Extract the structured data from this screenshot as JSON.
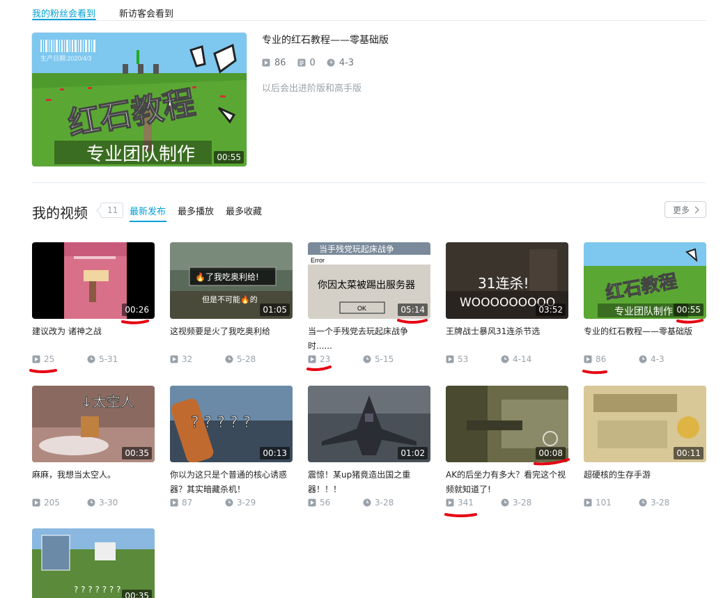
{
  "top_tabs": [
    {
      "label": "我的粉丝会看到",
      "active": true
    },
    {
      "label": "新访客会看到",
      "active": false
    }
  ],
  "featured": {
    "title": "专业的红石教程——零基础版",
    "plays": "86",
    "danmaku": "0",
    "date": "4-3",
    "description": "以后会出进阶版和高手版",
    "duration": "00:55",
    "thumb_text_main": "红石教程",
    "thumb_text_sub": "专业团队制作",
    "thumb_text_date": "生产日期:2020/4/3"
  },
  "videos_section": {
    "title": "我的视频",
    "count": "11",
    "sort_tabs": [
      {
        "label": "最新发布",
        "active": true
      },
      {
        "label": "最多播放",
        "active": false
      },
      {
        "label": "最多收藏",
        "active": false
      }
    ],
    "more_label": "更多"
  },
  "videos": [
    {
      "title": "建议改为 诸神之战",
      "duration": "00:26",
      "plays": "25",
      "date": "5-31",
      "thumb_text": ""
    },
    {
      "title": "这视频要是火了我吃奥利给",
      "duration": "01:05",
      "plays": "32",
      "date": "5-28",
      "thumb_text": "🔥了我吃奥利给!",
      "thumb_text2": "但是不可能🔥的"
    },
    {
      "title": "当一个手残党去玩起床战争时......",
      "duration": "05:14",
      "plays": "23",
      "date": "5-15",
      "thumb_text": "当手残党玩起床战争",
      "thumb_text2": "你因太菜被踢出服务器",
      "thumb_error": "Error",
      "thumb_ok": "OK"
    },
    {
      "title": "王牌战士暴风31连杀节选",
      "duration": "03:52",
      "plays": "53",
      "date": "4-14",
      "thumb_text": "31连杀!",
      "thumb_text2": "WOOOOOOOOO"
    },
    {
      "title": "专业的红石教程——零基础版",
      "duration": "00:55",
      "plays": "86",
      "date": "4-3",
      "thumb_text": "红石教程",
      "thumb_text2": "专业团队制作"
    },
    {
      "title": "麻麻，我想当太空人。",
      "duration": "00:35",
      "plays": "205",
      "date": "3-30",
      "thumb_text": "↓太空人"
    },
    {
      "title": "你以为这只是个普通的核心诱惑器？其实暗藏杀机！",
      "duration": "00:13",
      "plays": "87",
      "date": "3-29",
      "thumb_text": "? ? ? ? ?"
    },
    {
      "title": "震惊！某up猪竟造出国之重器！！！",
      "duration": "01:02",
      "plays": "56",
      "date": "3-28",
      "thumb_text": ""
    },
    {
      "title": "AK的后坐力有多大？看完这个视频就知道了!",
      "duration": "00:08",
      "plays": "341",
      "date": "3-28",
      "thumb_text": ""
    },
    {
      "title": "超硬核的生存手游",
      "duration": "00:11",
      "plays": "101",
      "date": "3-28",
      "thumb_text": ""
    },
    {
      "title": "",
      "duration": "00:35",
      "plays": "",
      "date": "",
      "thumb_text": "? ? ? ? ? ? ?"
    }
  ],
  "colors": {
    "accent": "#00a1d6",
    "annotation_red": "#e60012",
    "meta_gray": "#99a2aa"
  }
}
